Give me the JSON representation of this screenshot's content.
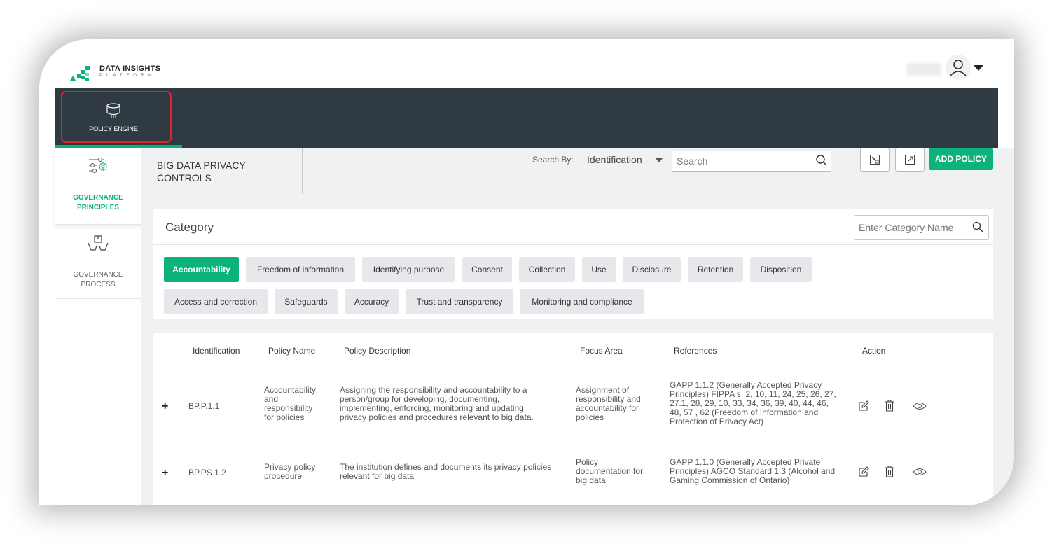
{
  "app": {
    "logo_title": "DATA INSIGHTS",
    "logo_subtitle": "PLATFORM",
    "accent_color": "#0bb37a",
    "dark_bar_color": "#2f3a42",
    "highlight_color": "#e0242c"
  },
  "nav": {
    "policy_engine_label": "POLICY ENGINE"
  },
  "sidebar": {
    "items": [
      {
        "label_line1": "GOVERNANCE",
        "label_line2": "PRINCIPLES",
        "icon": "sliders-gear-icon",
        "active": true
      },
      {
        "label_line1": "GOVERNANCE",
        "label_line2": "PROCESS",
        "icon": "hands-box-icon",
        "active": false
      }
    ]
  },
  "toolbar": {
    "page_title_line1": "BIG DATA PRIVACY",
    "page_title_line2": "CONTROLS",
    "search_by_label": "Search By:",
    "search_by_value": "Identification",
    "search_placeholder": "Search",
    "add_policy_label": "ADD POLICY"
  },
  "category": {
    "title": "Category",
    "search_placeholder": "Enter Category Name",
    "chips": [
      {
        "label": "Accountability",
        "active": true
      },
      {
        "label": "Freedom of information"
      },
      {
        "label": "Identifying purpose"
      },
      {
        "label": "Consent"
      },
      {
        "label": "Collection"
      },
      {
        "label": "Use"
      },
      {
        "label": "Disclosure"
      },
      {
        "label": "Retention"
      },
      {
        "label": "Disposition"
      },
      {
        "label": "Access and correction"
      },
      {
        "label": "Safeguards"
      },
      {
        "label": "Accuracy"
      },
      {
        "label": "Trust and transparency"
      },
      {
        "label": "Monitoring and compliance"
      }
    ]
  },
  "table": {
    "headers": [
      "Identification",
      "Policy Name",
      "Policy Description",
      "Focus Area",
      "References",
      "Action"
    ],
    "rows": [
      {
        "id": "BP.P.1.1",
        "name": [
          "Accountability",
          "and",
          "responsibility",
          "for policies"
        ],
        "description": [
          "Assigning the responsibility and accountability to a",
          "person/group for developing, documenting,",
          "implementing, enforcing, monitoring and updating",
          "privacy policies and procedures relevant to big data."
        ],
        "focus": [
          "Assignment of",
          "responsibility and",
          "accountability for",
          "policies"
        ],
        "references": [
          "GAPP 1.1.2 (Generally Accepted Privacy",
          "Principles) FIPPA s. 2, 10, 11, 24, 25, 26, 27,",
          "27.1, 28, 29, 10, 33, 34, 36, 39, 40, 44, 46,",
          "48, 57 , 62 (Freedom of Information and",
          "Protection of Privacy Act)"
        ]
      },
      {
        "id": "BP.PS.1.2",
        "name": [
          "Privacy policy",
          "procedure"
        ],
        "description": [
          "The institution defines and documents its privacy policies",
          "relevant for big data"
        ],
        "focus": [
          "Policy",
          "documentation for",
          "big data"
        ],
        "references": [
          "GAPP 1.1.0 (Generally Accepted Private",
          "Principles) AGCO Standard 1.3 (Alcohol and",
          "Gaming Commission of Ontario)"
        ]
      }
    ]
  }
}
